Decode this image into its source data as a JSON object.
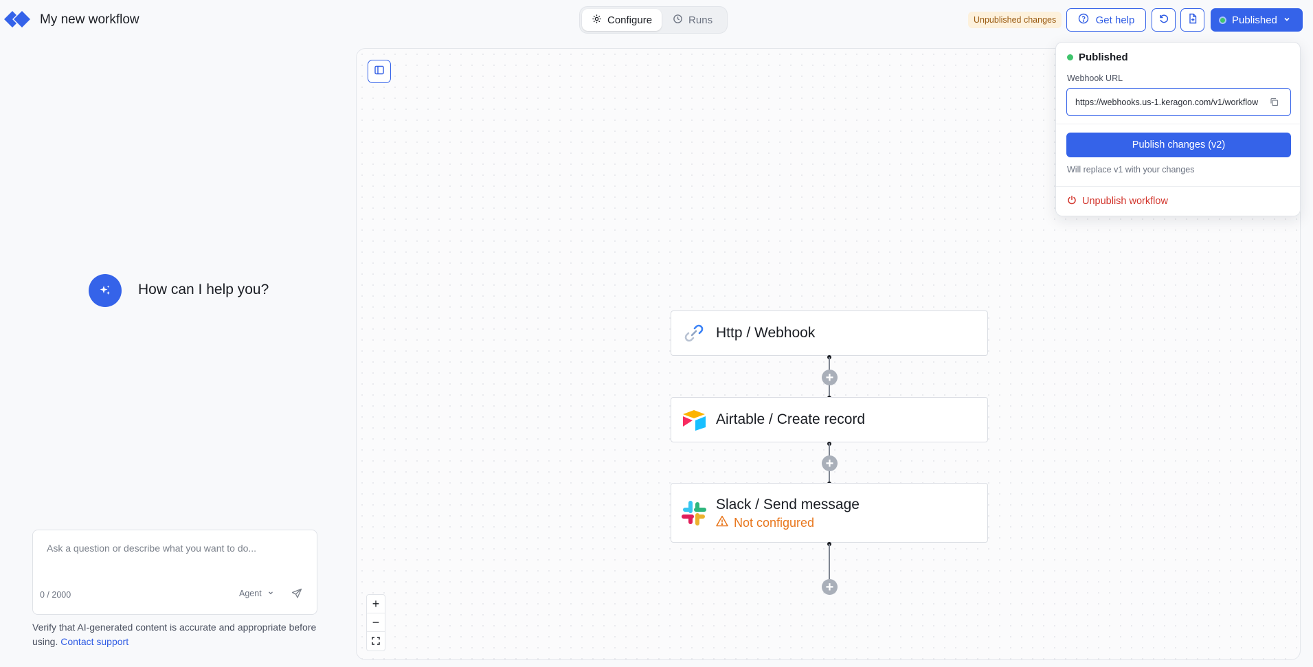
{
  "header": {
    "workflow_title": "My new workflow",
    "tabs": [
      {
        "label": "Configure",
        "icon": "gear-icon",
        "active": true
      },
      {
        "label": "Runs",
        "icon": "clock-icon",
        "active": false
      }
    ],
    "unpublished_badge": "Unpublished changes",
    "help_label": "Get help",
    "publish_label": "Published"
  },
  "chat": {
    "prompt": "How can I help you?",
    "placeholder": "Ask a question or describe what you want to do...",
    "value": "",
    "char_count": "0 / 2000",
    "mode": "Agent",
    "disclaimer": "Verify that AI-generated content is accurate and appropriate before using.",
    "support_link": "Contact support"
  },
  "canvas": {
    "nodes": [
      {
        "title": "Http / Webhook",
        "icon": "link-icon"
      },
      {
        "title": "Airtable / Create record",
        "icon": "airtable-icon"
      },
      {
        "title": "Slack / Send message",
        "icon": "slack-icon",
        "warning": "Not configured"
      }
    ],
    "zoom": {
      "in": "+",
      "out": "−"
    }
  },
  "publish_popover": {
    "status": "Published",
    "webhook_label": "Webhook URL",
    "webhook_url": "https://webhooks.us-1.keragon.com/v1/workflow",
    "publish_button": "Publish changes (v2)",
    "publish_note": "Will replace v1 with your changes",
    "unpublish_label": "Unpublish workflow"
  },
  "colors": {
    "accent": "#3563e9",
    "success": "#3fc46c",
    "warning": "#e8761c",
    "danger": "#d2342b",
    "badge_bg": "#fdf1dc"
  }
}
